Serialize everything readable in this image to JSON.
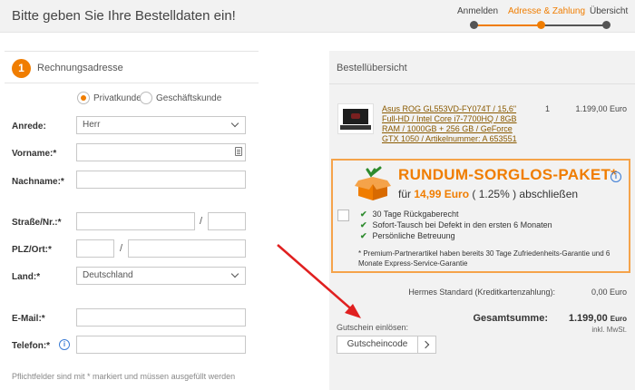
{
  "header": {
    "title": "Bitte geben Sie Ihre Bestelldaten ein!",
    "steps": [
      "Anmelden",
      "Adresse & Zahlung",
      "Übersicht"
    ],
    "active_step": 1,
    "accent_color": "#f07d00"
  },
  "billing": {
    "step_number": "1",
    "title": "Rechnungsadresse",
    "customer_types": [
      "Privatkunde",
      "Geschäftskunde"
    ],
    "selected_customer_type": "Privatkunde",
    "labels": {
      "salutation": "Anrede:",
      "first_name": "Vorname:*",
      "last_name": "Nachname:*",
      "street": "Straße/Nr.:*",
      "zip_city": "PLZ/Ort:*",
      "country": "Land:*",
      "email": "E-Mail:*",
      "phone": "Telefon:*"
    },
    "values": {
      "salutation": "Herr",
      "first_name": "",
      "last_name": "",
      "street": "",
      "house_number": "",
      "zip": "",
      "city": "",
      "country": "Deutschland",
      "email": "",
      "phone": ""
    },
    "separator": "/",
    "footnote": "Pflichtfelder sind mit * markiert und müssen ausgefüllt werden"
  },
  "summary": {
    "title": "Bestellübersicht",
    "product": {
      "name": "Asus ROG GL553VD-FY074T / 15,6\" Full-HD / Intel Core i7-7700HQ / 8GB RAM / 1000GB + 256 GB / GeForce GTX 1050 / Artikelnummer: A 653551",
      "quantity": "1",
      "price": "1.199,00 Euro"
    },
    "promo": {
      "title": "RUNDUM-SORGLOS-PAKET*",
      "price_prefix": "für ",
      "price": "14,99 Euro",
      "price_suffix": " ( 1.25% ) abschließen",
      "benefits": [
        "30 Tage Rückgaberecht",
        "Sofort-Tausch bei Defekt in den ersten 6 Monaten",
        "Persönliche Betreuung"
      ],
      "note": "* Premium-Partnerartikel haben bereits 30 Tage Zufriedenheits-Garantie und 6 Monate Express-Service-Garantie",
      "checked": false
    },
    "shipping_label": "Hermes Standard (Kreditkartenzahlung):",
    "shipping_price": "0,00 Euro",
    "total_label": "Gesamtsumme:",
    "total_amount": "1.199,00",
    "total_currency": "Euro",
    "vat_note": "inkl. MwSt.",
    "voucher_label": "Gutschein einlösen:",
    "voucher_placeholder": "Gutscheincode"
  },
  "icons": {
    "info": "info-icon",
    "card": "contact-card-icon",
    "box": "package-box-icon",
    "arrow_color": "#e02020"
  }
}
